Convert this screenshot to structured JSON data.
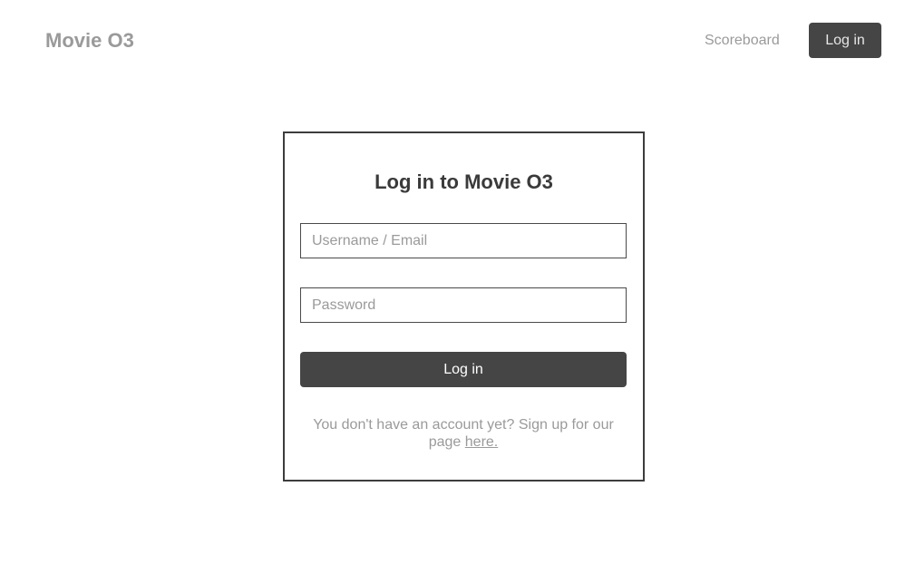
{
  "header": {
    "brand": "Movie O3",
    "nav": {
      "scoreboard_label": "Scoreboard",
      "login_label": "Log in"
    }
  },
  "login_form": {
    "title": "Log in to Movie O3",
    "username_placeholder": "Username / Email",
    "username_value": "",
    "password_placeholder": "Password",
    "password_value": "",
    "submit_label": "Log in",
    "signup_text": "You don't have an account yet? Sign up for our page",
    "signup_link_label": "here."
  },
  "colors": {
    "primary_button": "#454545",
    "muted_text": "#9a9a9a",
    "heading_text": "#3a3a3a",
    "card_border": "#3d3d3d"
  }
}
